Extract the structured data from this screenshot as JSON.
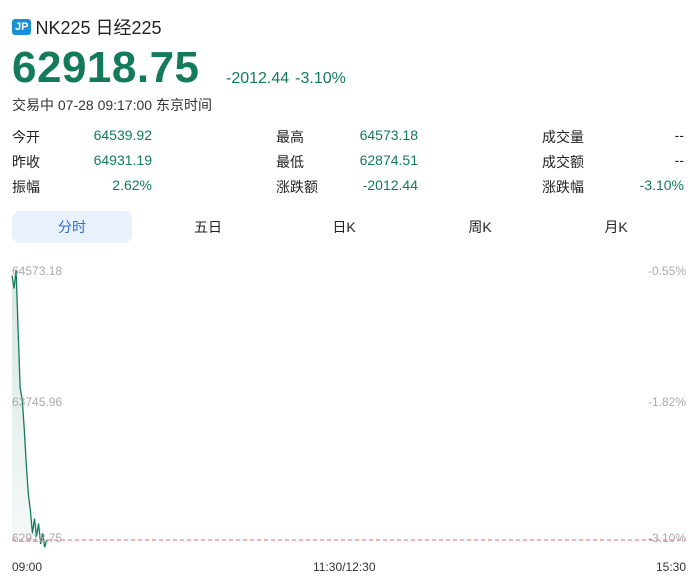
{
  "header": {
    "badge": "JP",
    "title": "NK225 日经225"
  },
  "quote": {
    "price": "62918.75",
    "change": "-2012.44",
    "change_pct": "-3.10%",
    "status": "交易中 07-28 09:17:00 东京时间"
  },
  "stats": [
    [
      {
        "label": "今开",
        "value": "64539.92"
      },
      {
        "label": "最高",
        "value": "64573.18"
      },
      {
        "label": "成交量",
        "value": "--"
      }
    ],
    [
      {
        "label": "昨收",
        "value": "64931.19"
      },
      {
        "label": "最低",
        "value": "62874.51"
      },
      {
        "label": "成交额",
        "value": "--"
      }
    ],
    [
      {
        "label": "振幅",
        "value": "2.62%"
      },
      {
        "label": "涨跌额",
        "value": "-2012.44"
      },
      {
        "label": "涨跌幅",
        "value": "-3.10%"
      }
    ]
  ],
  "tabs": [
    {
      "label": "分时",
      "active": true
    },
    {
      "label": "五日",
      "active": false
    },
    {
      "label": "日K",
      "active": false
    },
    {
      "label": "周K",
      "active": false
    },
    {
      "label": "月K",
      "active": false
    }
  ],
  "colors": {
    "down": "#137a5c",
    "accent": "#2f6ed0",
    "ref_line": "#e06a6a"
  },
  "chart_data": {
    "type": "area",
    "y_labels_left": [
      "64573.18",
      "63745.96",
      "62918.75"
    ],
    "y_labels_right": [
      "-0.55%",
      "-1.82%",
      "-3.10%"
    ],
    "x_labels": [
      "09:00",
      "11:30/12:30",
      "15:30"
    ],
    "ylim": [
      62918.75,
      64573.18
    ],
    "session_minutes": 330,
    "x": [
      0,
      1,
      2,
      3,
      4,
      5,
      6,
      7,
      8,
      9,
      10,
      11,
      12,
      13,
      14,
      15,
      16,
      17
    ],
    "values": [
      64539.92,
      64460,
      64573.18,
      64200,
      63850,
      63780,
      63600,
      63380,
      63200,
      63100,
      62960,
      63050,
      62940,
      63020,
      62895,
      62960,
      62874.51,
      62918.75
    ],
    "reference_line": 62918.75
  }
}
